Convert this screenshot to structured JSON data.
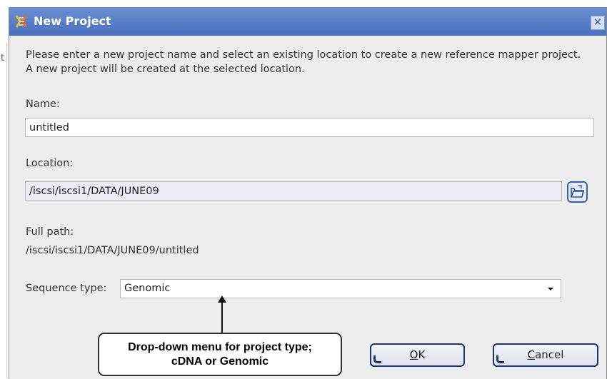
{
  "window": {
    "title": "New Project"
  },
  "instructions": "Please enter a new project name and select an existing location to create a new reference mapper project. A new project will be created at the selected location.",
  "name": {
    "label": "Name:",
    "value": "untitled"
  },
  "location": {
    "label": "Location:",
    "value": "/iscsi/iscsi1/DATA/JUNE09",
    "browse_icon": "folder-open-icon"
  },
  "full_path": {
    "label": "Full path:",
    "value": "/iscsi/iscsi1/DATA/JUNE09/untitled"
  },
  "sequence_type": {
    "label": "Sequence type:",
    "value": "Genomic"
  },
  "callout": {
    "line1": "Drop-down menu for project type;",
    "line2": "cDNA or Genomic"
  },
  "buttons": {
    "ok": {
      "mnemonic": "O",
      "rest": "K"
    },
    "cancel": {
      "mnemonic": "C",
      "rest": "ancel"
    }
  },
  "side_fragment": "t",
  "colors": {
    "titlebar": "#4a70bf",
    "dialog_bg": "#ededed",
    "button_border": "#22346e"
  }
}
